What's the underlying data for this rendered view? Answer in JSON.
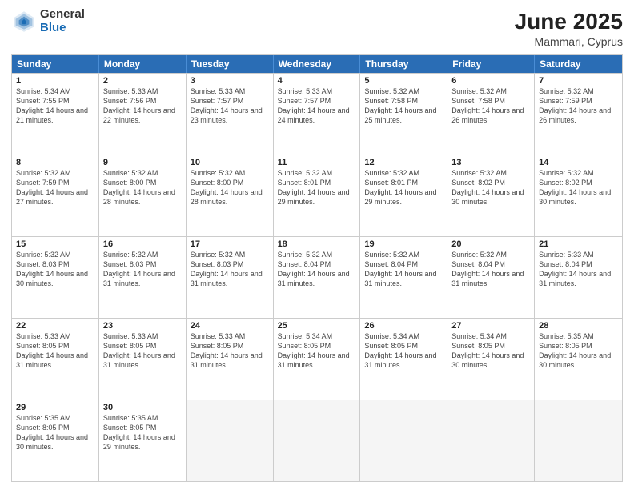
{
  "logo": {
    "general": "General",
    "blue": "Blue"
  },
  "header": {
    "month": "June 2025",
    "location": "Mammari, Cyprus"
  },
  "weekdays": [
    "Sunday",
    "Monday",
    "Tuesday",
    "Wednesday",
    "Thursday",
    "Friday",
    "Saturday"
  ],
  "rows": [
    [
      {
        "day": "1",
        "sunrise": "Sunrise: 5:34 AM",
        "sunset": "Sunset: 7:55 PM",
        "daylight": "Daylight: 14 hours and 21 minutes."
      },
      {
        "day": "2",
        "sunrise": "Sunrise: 5:33 AM",
        "sunset": "Sunset: 7:56 PM",
        "daylight": "Daylight: 14 hours and 22 minutes."
      },
      {
        "day": "3",
        "sunrise": "Sunrise: 5:33 AM",
        "sunset": "Sunset: 7:57 PM",
        "daylight": "Daylight: 14 hours and 23 minutes."
      },
      {
        "day": "4",
        "sunrise": "Sunrise: 5:33 AM",
        "sunset": "Sunset: 7:57 PM",
        "daylight": "Daylight: 14 hours and 24 minutes."
      },
      {
        "day": "5",
        "sunrise": "Sunrise: 5:32 AM",
        "sunset": "Sunset: 7:58 PM",
        "daylight": "Daylight: 14 hours and 25 minutes."
      },
      {
        "day": "6",
        "sunrise": "Sunrise: 5:32 AM",
        "sunset": "Sunset: 7:58 PM",
        "daylight": "Daylight: 14 hours and 26 minutes."
      },
      {
        "day": "7",
        "sunrise": "Sunrise: 5:32 AM",
        "sunset": "Sunset: 7:59 PM",
        "daylight": "Daylight: 14 hours and 26 minutes."
      }
    ],
    [
      {
        "day": "8",
        "sunrise": "Sunrise: 5:32 AM",
        "sunset": "Sunset: 7:59 PM",
        "daylight": "Daylight: 14 hours and 27 minutes."
      },
      {
        "day": "9",
        "sunrise": "Sunrise: 5:32 AM",
        "sunset": "Sunset: 8:00 PM",
        "daylight": "Daylight: 14 hours and 28 minutes."
      },
      {
        "day": "10",
        "sunrise": "Sunrise: 5:32 AM",
        "sunset": "Sunset: 8:00 PM",
        "daylight": "Daylight: 14 hours and 28 minutes."
      },
      {
        "day": "11",
        "sunrise": "Sunrise: 5:32 AM",
        "sunset": "Sunset: 8:01 PM",
        "daylight": "Daylight: 14 hours and 29 minutes."
      },
      {
        "day": "12",
        "sunrise": "Sunrise: 5:32 AM",
        "sunset": "Sunset: 8:01 PM",
        "daylight": "Daylight: 14 hours and 29 minutes."
      },
      {
        "day": "13",
        "sunrise": "Sunrise: 5:32 AM",
        "sunset": "Sunset: 8:02 PM",
        "daylight": "Daylight: 14 hours and 30 minutes."
      },
      {
        "day": "14",
        "sunrise": "Sunrise: 5:32 AM",
        "sunset": "Sunset: 8:02 PM",
        "daylight": "Daylight: 14 hours and 30 minutes."
      }
    ],
    [
      {
        "day": "15",
        "sunrise": "Sunrise: 5:32 AM",
        "sunset": "Sunset: 8:03 PM",
        "daylight": "Daylight: 14 hours and 30 minutes."
      },
      {
        "day": "16",
        "sunrise": "Sunrise: 5:32 AM",
        "sunset": "Sunset: 8:03 PM",
        "daylight": "Daylight: 14 hours and 31 minutes."
      },
      {
        "day": "17",
        "sunrise": "Sunrise: 5:32 AM",
        "sunset": "Sunset: 8:03 PM",
        "daylight": "Daylight: 14 hours and 31 minutes."
      },
      {
        "day": "18",
        "sunrise": "Sunrise: 5:32 AM",
        "sunset": "Sunset: 8:04 PM",
        "daylight": "Daylight: 14 hours and 31 minutes."
      },
      {
        "day": "19",
        "sunrise": "Sunrise: 5:32 AM",
        "sunset": "Sunset: 8:04 PM",
        "daylight": "Daylight: 14 hours and 31 minutes."
      },
      {
        "day": "20",
        "sunrise": "Sunrise: 5:32 AM",
        "sunset": "Sunset: 8:04 PM",
        "daylight": "Daylight: 14 hours and 31 minutes."
      },
      {
        "day": "21",
        "sunrise": "Sunrise: 5:33 AM",
        "sunset": "Sunset: 8:04 PM",
        "daylight": "Daylight: 14 hours and 31 minutes."
      }
    ],
    [
      {
        "day": "22",
        "sunrise": "Sunrise: 5:33 AM",
        "sunset": "Sunset: 8:05 PM",
        "daylight": "Daylight: 14 hours and 31 minutes."
      },
      {
        "day": "23",
        "sunrise": "Sunrise: 5:33 AM",
        "sunset": "Sunset: 8:05 PM",
        "daylight": "Daylight: 14 hours and 31 minutes."
      },
      {
        "day": "24",
        "sunrise": "Sunrise: 5:33 AM",
        "sunset": "Sunset: 8:05 PM",
        "daylight": "Daylight: 14 hours and 31 minutes."
      },
      {
        "day": "25",
        "sunrise": "Sunrise: 5:34 AM",
        "sunset": "Sunset: 8:05 PM",
        "daylight": "Daylight: 14 hours and 31 minutes."
      },
      {
        "day": "26",
        "sunrise": "Sunrise: 5:34 AM",
        "sunset": "Sunset: 8:05 PM",
        "daylight": "Daylight: 14 hours and 31 minutes."
      },
      {
        "day": "27",
        "sunrise": "Sunrise: 5:34 AM",
        "sunset": "Sunset: 8:05 PM",
        "daylight": "Daylight: 14 hours and 30 minutes."
      },
      {
        "day": "28",
        "sunrise": "Sunrise: 5:35 AM",
        "sunset": "Sunset: 8:05 PM",
        "daylight": "Daylight: 14 hours and 30 minutes."
      }
    ],
    [
      {
        "day": "29",
        "sunrise": "Sunrise: 5:35 AM",
        "sunset": "Sunset: 8:05 PM",
        "daylight": "Daylight: 14 hours and 30 minutes."
      },
      {
        "day": "30",
        "sunrise": "Sunrise: 5:35 AM",
        "sunset": "Sunset: 8:05 PM",
        "daylight": "Daylight: 14 hours and 29 minutes."
      },
      {
        "day": "",
        "sunrise": "",
        "sunset": "",
        "daylight": ""
      },
      {
        "day": "",
        "sunrise": "",
        "sunset": "",
        "daylight": ""
      },
      {
        "day": "",
        "sunrise": "",
        "sunset": "",
        "daylight": ""
      },
      {
        "day": "",
        "sunrise": "",
        "sunset": "",
        "daylight": ""
      },
      {
        "day": "",
        "sunrise": "",
        "sunset": "",
        "daylight": ""
      }
    ]
  ]
}
